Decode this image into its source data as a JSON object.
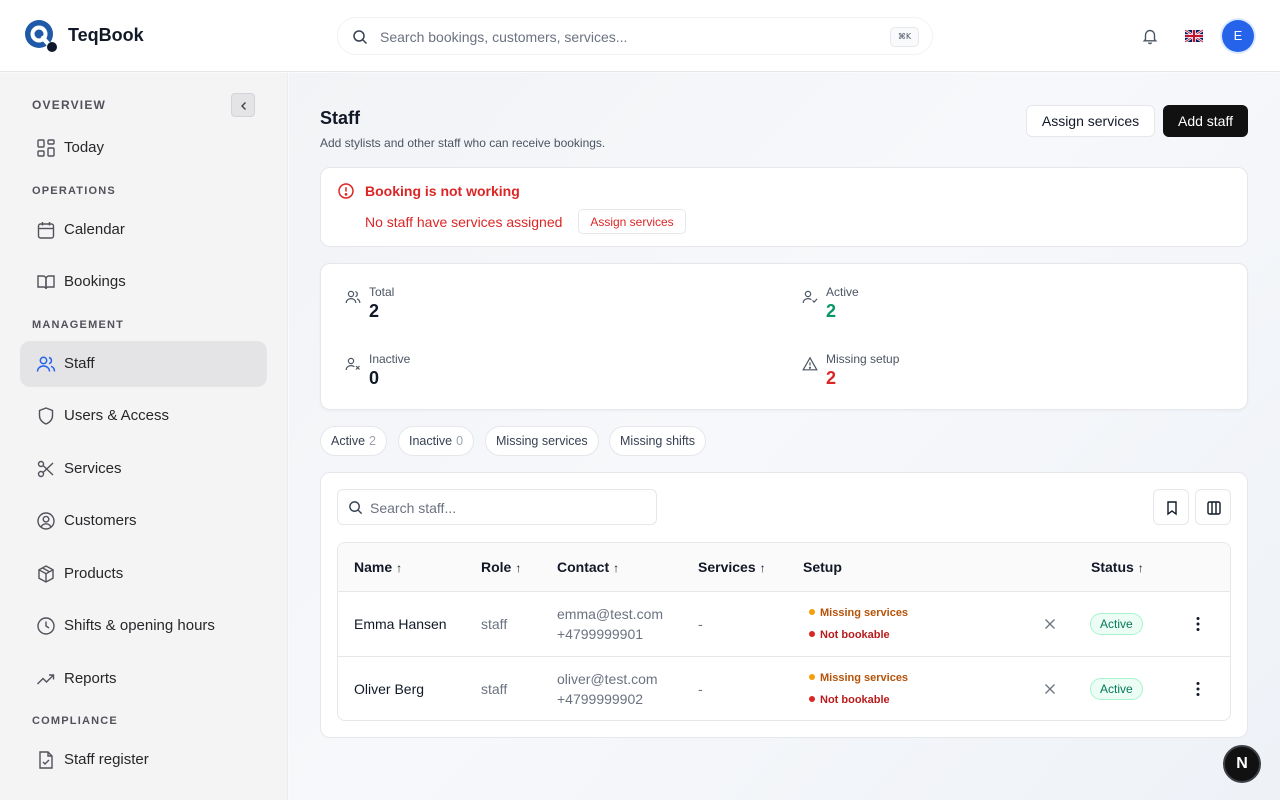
{
  "app": {
    "brand": "TeqBook",
    "search_placeholder": "Search bookings, customers, services...",
    "search_shortcut": "⌘K",
    "user_initial": "E",
    "language": "English (UK) flag",
    "accent_color": "#2563eb"
  },
  "sidebar": {
    "overview": "OVERVIEW",
    "operations": "OPERATIONS",
    "management": "MANAGEMENT",
    "compliance": "COMPLIANCE",
    "items": {
      "today": "Today",
      "calendar": "Calendar",
      "bookings": "Bookings",
      "staff": "Staff",
      "users": "Users & Access",
      "services": "Services",
      "customers": "Customers",
      "products": "Products",
      "shifts": "Shifts & opening hours",
      "reports": "Reports",
      "register": "Staff register"
    },
    "active_item": "Staff"
  },
  "page": {
    "title": "Staff",
    "subtitle": "Add stylists and other staff who can receive bookings.",
    "assign_label": "Assign services",
    "add_label": "Add staff"
  },
  "alert": {
    "title": "Booking is not working",
    "description": "No staff have services assigned",
    "action_label": "Assign services"
  },
  "stats": {
    "total_label": "Total",
    "total_value": "2",
    "active_label": "Active",
    "active_value": "2",
    "inactive_label": "Inactive",
    "inactive_value": "0",
    "missing_label": "Missing setup",
    "missing_value": "2"
  },
  "filters": {
    "active_label": "Active",
    "active_count": "2",
    "inactive_label": "Inactive",
    "inactive_count": "0",
    "missing_services": "Missing services",
    "missing_shifts": "Missing shifts"
  },
  "table": {
    "search_placeholder": "Search staff...",
    "columns": {
      "name": "Name",
      "role": "Role",
      "contact": "Contact",
      "services": "Services",
      "setup": "Setup",
      "status": "Status"
    },
    "sort_arrow": "↑",
    "rows": [
      {
        "name": "Emma Hansen",
        "role": "staff",
        "email": "emma@test.com",
        "phone": "+4799999901",
        "services": "-",
        "setup_1": "Missing services",
        "setup_2": "Not bookable",
        "status": "Active"
      },
      {
        "name": "Oliver Berg",
        "role": "staff",
        "email": "oliver@test.com",
        "phone": "+4799999902",
        "services": "-",
        "setup_1": "Missing services",
        "setup_2": "Not bookable",
        "status": "Active"
      }
    ]
  },
  "devtools_badge": "N"
}
